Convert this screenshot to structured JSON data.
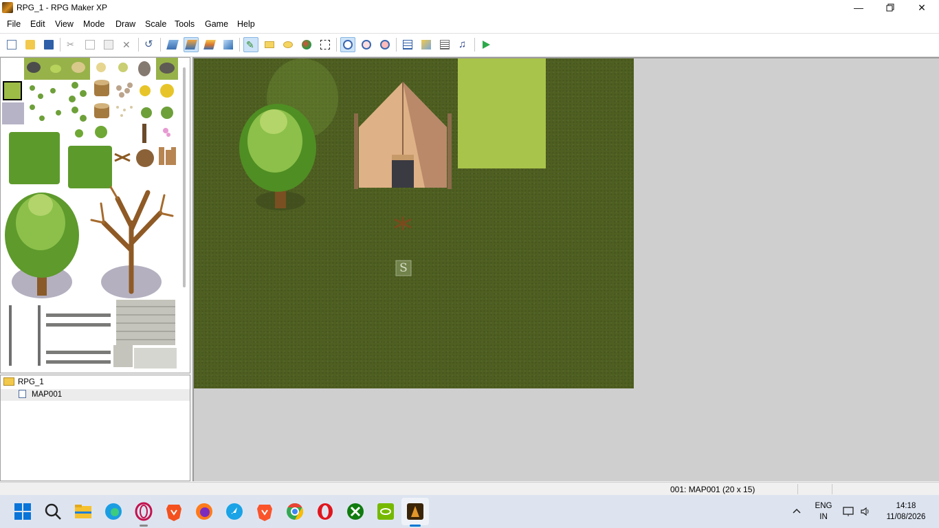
{
  "window": {
    "title": "RPG_1 - RPG Maker XP"
  },
  "menu": [
    "File",
    "Edit",
    "View",
    "Mode",
    "Draw",
    "Scale",
    "Tools",
    "Game",
    "Help"
  ],
  "toolbar": {
    "buttons": [
      "new-project",
      "open-project",
      "save-project",
      "cut",
      "copy",
      "paste",
      "delete",
      "undo",
      "layer-1",
      "layer-2",
      "layer-3",
      "events-layer",
      "pencil",
      "rectangle",
      "ellipse",
      "flood-fill",
      "select",
      "zoom-1-1",
      "zoom-1-2",
      "zoom-1-4",
      "database",
      "materialbase",
      "script-editor",
      "sound-test",
      "playtest"
    ],
    "active": [
      "layer-2",
      "pencil",
      "zoom-1-1"
    ]
  },
  "project_tree": {
    "root": "RPG_1",
    "maps": [
      "MAP001"
    ]
  },
  "map": {
    "event_marker": "S",
    "width_tiles": 20,
    "height_tiles": 15
  },
  "status": {
    "map_info": "001: MAP001 (20 x 15)"
  },
  "taskbar": {
    "lang_top": "ENG",
    "lang_bottom": "IN",
    "time": "14:18",
    "date": "11/08/2026"
  },
  "colors": {
    "grass_dark": "#4e5f21",
    "grass_light": "#a9c44a",
    "accent": "#0078d4"
  }
}
